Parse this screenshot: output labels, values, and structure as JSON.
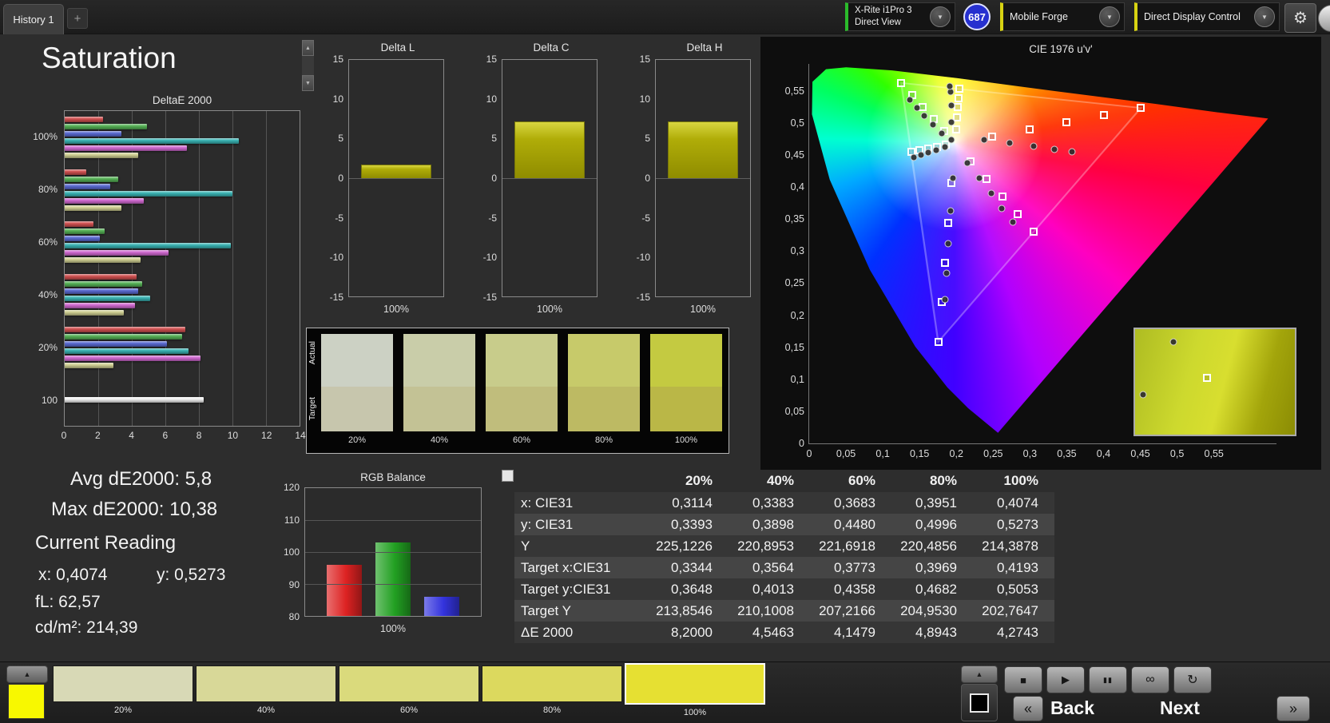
{
  "header": {
    "tab_label": "History 1",
    "add_tab_label": "+",
    "meter_line1": "X-Rite i1Pro 3",
    "meter_line2": "Direct View",
    "badge_count": "687",
    "source_label": "Mobile Forge",
    "display_control_label": "Direct Display Control",
    "gear_icon": "⚙",
    "dropdown_arrow": "▼"
  },
  "page": {
    "title": "Saturation"
  },
  "misc": {
    "scroll_up": "▲",
    "scroll_down": "▼"
  },
  "stats": {
    "avg": "Avg dE2000: 5,8",
    "max": "Max dE2000: 10,38",
    "current_heading": "Current Reading",
    "x": "x: 0,4074",
    "y": "y: 0,5273",
    "fl": "fL: 62,57",
    "cdm2": "cd/m²: 214,39"
  },
  "chart_data": [
    {
      "id": "deltae2000",
      "type": "bar",
      "orientation": "horizontal",
      "title": "DeltaE 2000",
      "categories": [
        "100%",
        "80%",
        "60%",
        "40%",
        "20%",
        "100"
      ],
      "series_colors": [
        "#cf5050",
        "#55b055",
        "#5a6ad0",
        "#39b2b2",
        "#d069d0",
        "#cfcf92"
      ],
      "white_color": "#f0f0f0",
      "groups": [
        [
          2.3,
          4.9,
          3.4,
          10.4,
          7.3,
          4.4
        ],
        [
          1.3,
          3.2,
          2.7,
          10.0,
          4.7,
          3.4
        ],
        [
          1.7,
          2.4,
          2.1,
          9.9,
          6.2,
          4.5
        ],
        [
          4.3,
          4.6,
          4.4,
          5.1,
          4.2,
          3.5
        ],
        [
          7.2,
          7.0,
          6.1,
          7.4,
          8.1,
          2.9
        ],
        [
          8.3
        ]
      ],
      "xlim": [
        0,
        14
      ],
      "xticks": [
        "0",
        "2",
        "4",
        "6",
        "8",
        "10",
        "12",
        "14"
      ]
    },
    {
      "id": "delta_l",
      "type": "bar",
      "title": "Delta L",
      "categories": [
        "100%"
      ],
      "values": [
        1.7
      ],
      "ylim": [
        -15,
        15
      ],
      "yticks": [
        "15",
        "10",
        "5",
        "0",
        "-5",
        "-10",
        "-15"
      ]
    },
    {
      "id": "delta_c",
      "type": "bar",
      "title": "Delta C",
      "categories": [
        "100%"
      ],
      "values": [
        7.2
      ],
      "ylim": [
        -15,
        15
      ],
      "yticks": [
        "15",
        "10",
        "5",
        "0",
        "-5",
        "-10",
        "-15"
      ]
    },
    {
      "id": "delta_h",
      "type": "bar",
      "title": "Delta H",
      "categories": [
        "100%"
      ],
      "values": [
        7.2
      ],
      "ylim": [
        -15,
        15
      ],
      "yticks": [
        "15",
        "10",
        "5",
        "0",
        "-5",
        "-10",
        "-15"
      ]
    },
    {
      "id": "rgb_balance",
      "type": "bar",
      "title": "RGB Balance",
      "categories": [
        "Red",
        "Green",
        "Blue"
      ],
      "values": [
        96,
        103,
        86
      ],
      "colors": [
        "#dd2222",
        "#22a022",
        "#3333dd"
      ],
      "ylim": [
        80,
        120
      ],
      "yticks": [
        "120",
        "110",
        "100",
        "90",
        "80"
      ],
      "xlabel": "100%"
    },
    {
      "id": "cie",
      "type": "scatter",
      "title": "CIE 1976 u'v'",
      "xlim": [
        0,
        0.635
      ],
      "ylim": [
        0,
        0.592
      ],
      "xticks": [
        "0",
        "0,05",
        "0,1",
        "0,15",
        "0,2",
        "0,25",
        "0,3",
        "0,35",
        "0,4",
        "0,45",
        "0,5",
        "0,55"
      ],
      "yticks": [
        "0,55",
        "0,5",
        "0,45",
        "0,4",
        "0,35",
        "0,3",
        "0,25",
        "0,2",
        "0,15",
        "0,1",
        "0,05",
        "0"
      ],
      "target_points": [
        [
          0.1994,
          0.4894
        ],
        [
          0.2007,
          0.5085
        ],
        [
          0.2019,
          0.5247
        ],
        [
          0.2029,
          0.5385
        ],
        [
          0.2039,
          0.5529
        ],
        [
          0.2486,
          0.479
        ],
        [
          0.2992,
          0.49
        ],
        [
          0.3498,
          0.501
        ],
        [
          0.4004,
          0.512
        ],
        [
          0.451,
          0.523
        ],
        [
          0.1834,
          0.4869
        ],
        [
          0.1688,
          0.5058
        ],
        [
          0.1542,
          0.5247
        ],
        [
          0.1396,
          0.5436
        ],
        [
          0.125,
          0.5625
        ],
        [
          0.1935,
          0.406
        ],
        [
          0.189,
          0.344
        ],
        [
          0.1845,
          0.282
        ],
        [
          0.18,
          0.22
        ],
        [
          0.1754,
          0.158
        ],
        [
          0.1861,
          0.4655
        ],
        [
          0.1742,
          0.463
        ],
        [
          0.1622,
          0.4605
        ],
        [
          0.1503,
          0.458
        ],
        [
          0.1384,
          0.4555
        ],
        [
          0.2194,
          0.4404
        ],
        [
          0.2408,
          0.4128
        ],
        [
          0.2622,
          0.3852
        ],
        [
          0.2836,
          0.3576
        ],
        [
          0.305,
          0.3298
        ]
      ],
      "measured_points": [
        [
          0.1932,
          0.4735
        ],
        [
          0.1933,
          0.5011
        ],
        [
          0.1928,
          0.5278
        ],
        [
          0.1926,
          0.548
        ],
        [
          0.1914,
          0.5575
        ],
        [
          0.238,
          0.473
        ],
        [
          0.272,
          0.468
        ],
        [
          0.305,
          0.464
        ],
        [
          0.333,
          0.459
        ],
        [
          0.357,
          0.455
        ],
        [
          0.18,
          0.483
        ],
        [
          0.168,
          0.497
        ],
        [
          0.156,
          0.511
        ],
        [
          0.146,
          0.524
        ],
        [
          0.137,
          0.536
        ],
        [
          0.195,
          0.414
        ],
        [
          0.192,
          0.363
        ],
        [
          0.189,
          0.312
        ],
        [
          0.187,
          0.266
        ],
        [
          0.185,
          0.224
        ],
        [
          0.184,
          0.462
        ],
        [
          0.173,
          0.458
        ],
        [
          0.162,
          0.454
        ],
        [
          0.152,
          0.45
        ],
        [
          0.142,
          0.446
        ],
        [
          0.215,
          0.437
        ],
        [
          0.231,
          0.414
        ],
        [
          0.247,
          0.39
        ],
        [
          0.262,
          0.367
        ],
        [
          0.277,
          0.345
        ]
      ],
      "inset": {
        "circles": [
          [
            24,
            12
          ],
          [
            5,
            62
          ]
        ],
        "squares": [
          [
            45,
            46
          ]
        ]
      }
    }
  ],
  "swatches": {
    "actual_label": "Actual",
    "target_label": "Target",
    "levels": [
      "20%",
      "40%",
      "60%",
      "80%",
      "100%"
    ],
    "actual_colors": [
      "#ccd1c4",
      "#c9cda9",
      "#c8cc8b",
      "#c7ca6a",
      "#c4ca41"
    ],
    "target_colors": [
      "#c7c6ad",
      "#c3c295",
      "#c0bd7c",
      "#bdba63",
      "#bab747"
    ]
  },
  "table": {
    "columns": [
      "20%",
      "40%",
      "60%",
      "80%",
      "100%"
    ],
    "rows": [
      {
        "label": "x: CIE31",
        "values": [
          "0,3114",
          "0,3383",
          "0,3683",
          "0,3951",
          "0,4074"
        ]
      },
      {
        "label": "y: CIE31",
        "values": [
          "0,3393",
          "0,3898",
          "0,4480",
          "0,4996",
          "0,5273"
        ]
      },
      {
        "label": "Y",
        "values": [
          "225,1226",
          "220,8953",
          "221,6918",
          "220,4856",
          "214,3878"
        ]
      },
      {
        "label": "Target x:CIE31",
        "values": [
          "0,3344",
          "0,3564",
          "0,3773",
          "0,3969",
          "0,4193"
        ]
      },
      {
        "label": "Target y:CIE31",
        "values": [
          "0,3648",
          "0,4013",
          "0,4358",
          "0,4682",
          "0,5053"
        ]
      },
      {
        "label": "Target Y",
        "values": [
          "213,8546",
          "210,1008",
          "207,2166",
          "204,9530",
          "202,7647"
        ]
      },
      {
        "label": "ΔE 2000",
        "values": [
          "8,2000",
          "4,5463",
          "4,1479",
          "4,8943",
          "4,2743"
        ]
      }
    ]
  },
  "bottom": {
    "patches": [
      {
        "label": "20%",
        "color": "#d8d9b6",
        "selected": false
      },
      {
        "label": "40%",
        "color": "#d8d898",
        "selected": false
      },
      {
        "label": "60%",
        "color": "#dada7c",
        "selected": false
      },
      {
        "label": "80%",
        "color": "#dcd95e",
        "selected": false
      },
      {
        "label": "100%",
        "color": "#e6e032",
        "selected": true
      }
    ],
    "current_patch_color": "#f8f800",
    "up_arrow": "▲",
    "playback": [
      {
        "name": "stop-icon",
        "glyph": "■"
      },
      {
        "name": "play-icon",
        "glyph": "▶"
      },
      {
        "name": "pause-icon",
        "glyph": "▮▮"
      },
      {
        "name": "loop-icon",
        "glyph": "∞"
      },
      {
        "name": "refresh-icon",
        "glyph": "↻"
      }
    ],
    "back_label": "Back",
    "next_label": "Next",
    "prev_icon": "«",
    "next_icon": "»"
  }
}
